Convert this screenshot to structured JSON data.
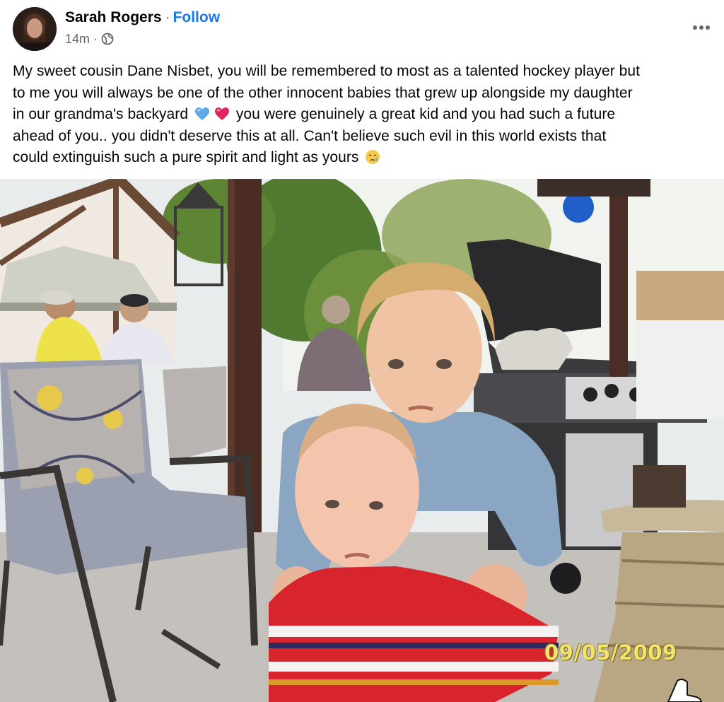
{
  "post": {
    "author": "Sarah Rogers",
    "separator": "·",
    "follow_label": "Follow",
    "time": "14m",
    "time_separator": "·",
    "audience_icon": "globe-icon",
    "more_icon": "more-options-icon",
    "text": {
      "line1": "My sweet cousin Dane Nisbet, you will be remembered to most as a talented hockey player but",
      "line2": "to me you will always be one of the other innocent babies that grew up alongside my daughter",
      "line3_a": "in our grandma's backyard",
      "emoji_1": "blue-heart-icon",
      "emoji_2": "red-heart-icon",
      "line3_b": "you were genuinely a great kid and you had such a future",
      "line4": "ahead of you.. you didn't deserve this at all. Can't believe such evil in this world exists that",
      "line5": "could extinguish such a pure spirit and light as yours",
      "emoji_3": "crying-face-icon"
    },
    "photo": {
      "date_stamp": "09/05/2009"
    }
  },
  "colors": {
    "link": "#1877f2",
    "secondary_text": "#65676b",
    "primary_text": "#050505"
  }
}
